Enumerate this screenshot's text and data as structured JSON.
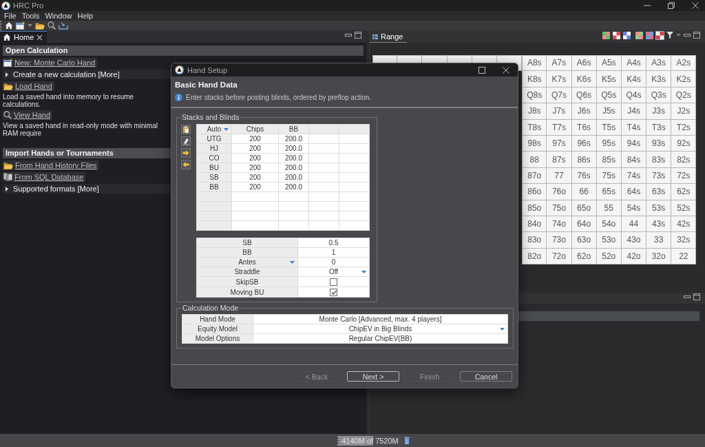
{
  "window": {
    "title": "HRC Pro"
  },
  "menu": [
    "File",
    "Tools",
    "Window",
    "Help"
  ],
  "home_pane": {
    "tab": {
      "label": "Home",
      "selected": true
    },
    "sections": [
      {
        "title": "Open Calculation",
        "items": [
          {
            "kind": "link",
            "label": "New: Monte Carlo Hand"
          },
          {
            "kind": "expander",
            "label": "Create a new calculation [More]",
            "expanded": false
          },
          {
            "kind": "link",
            "label": "Load Hand"
          },
          {
            "kind": "text",
            "label": "Load a saved hand into memory to resume calculations."
          },
          {
            "kind": "link",
            "label": "View Hand"
          },
          {
            "kind": "text",
            "label": "View a saved hand in read-only mode with minimal RAM require"
          }
        ]
      },
      {
        "title": "Import Hands or Tournaments",
        "items": [
          {
            "kind": "link",
            "label": "From Hand History Files"
          },
          {
            "kind": "link",
            "label": "From SQL Database"
          },
          {
            "kind": "expander",
            "label": "Supported formats [More]",
            "expanded": false
          }
        ]
      }
    ]
  },
  "range_pane": {
    "tab": {
      "label": "Range",
      "selected": true
    },
    "hands": [
      [
        "A8s",
        "A7s",
        "A6s",
        "A5s",
        "A4s",
        "A3s",
        "A2s"
      ],
      [
        "K8s",
        "K7s",
        "K6s",
        "K5s",
        "K4s",
        "K3s",
        "K2s"
      ],
      [
        "Q8s",
        "Q7s",
        "Q6s",
        "Q5s",
        "Q4s",
        "Q3s",
        "Q2s"
      ],
      [
        "J8s",
        "J7s",
        "J6s",
        "J5s",
        "J4s",
        "J3s",
        "J2s"
      ],
      [
        "T8s",
        "T7s",
        "T6s",
        "T5s",
        "T4s",
        "T3s",
        "T2s"
      ],
      [
        "98s",
        "97s",
        "96s",
        "95s",
        "94s",
        "93s",
        "92s"
      ],
      [
        "88",
        "87s",
        "86s",
        "85s",
        "84s",
        "83s",
        "82s"
      ],
      [
        "87o",
        "77",
        "76s",
        "75s",
        "74s",
        "73s",
        "72s"
      ],
      [
        "86o",
        "76o",
        "66",
        "65s",
        "64s",
        "63s",
        "62s"
      ],
      [
        "85o",
        "75o",
        "65o",
        "55",
        "54s",
        "53s",
        "52s"
      ],
      [
        "84o",
        "74o",
        "64o",
        "54o",
        "44",
        "43s",
        "42s"
      ],
      [
        "83o",
        "73o",
        "63o",
        "53o",
        "43o",
        "33",
        "32s"
      ],
      [
        "82o",
        "72o",
        "62o",
        "52o",
        "42o",
        "32o",
        "22"
      ]
    ]
  },
  "dialog": {
    "title": "Hand Setup",
    "heading": "Basic Hand Data",
    "info": "Enter stacks before posting blinds, ordered by preflop action.",
    "stacks": {
      "title": "Stacks and Blinds",
      "columns": [
        "Auto",
        "Chips",
        "BB"
      ],
      "rows": [
        [
          "UTG",
          "200",
          "200.0"
        ],
        [
          "HJ",
          "200",
          "200.0"
        ],
        [
          "CO",
          "200",
          "200.0"
        ],
        [
          "BU",
          "200",
          "200.0"
        ],
        [
          "SB",
          "200",
          "200.0"
        ],
        [
          "BB",
          "200",
          "200.0"
        ]
      ],
      "blinds": [
        {
          "label": "SB",
          "kind": "value",
          "value": "0.5"
        },
        {
          "label": "BB",
          "kind": "value",
          "value": "1"
        },
        {
          "label": "Antes",
          "kind": "label-menu",
          "value": "0"
        },
        {
          "label": "Straddle",
          "kind": "dropdown",
          "value": "Off"
        },
        {
          "label": "SkipSB",
          "kind": "checkbox",
          "checked": false
        },
        {
          "label": "Moving BU",
          "kind": "checkbox",
          "checked": true
        }
      ]
    },
    "calculation": {
      "title": "Calculation Mode",
      "rows": [
        {
          "label": "Hand Mode",
          "kind": "value",
          "value": "Monte Carlo [Advanced, max. 4 players]"
        },
        {
          "label": "Equity Model",
          "kind": "dropdown",
          "value": "ChipEV in Big Blinds"
        },
        {
          "label": "Model Options",
          "kind": "value",
          "value": "Regular ChipEV(BB)"
        }
      ]
    },
    "buttons": [
      {
        "label": "< Back",
        "disabled": true,
        "default": false
      },
      {
        "label": "Next >",
        "disabled": false,
        "default": true
      },
      {
        "label": "Finish",
        "disabled": true,
        "default": false
      },
      {
        "label": "Cancel",
        "disabled": false,
        "default": false
      }
    ]
  },
  "status_bar": {
    "memory": {
      "text": "4140M of 7520M",
      "level": 0.55
    }
  }
}
